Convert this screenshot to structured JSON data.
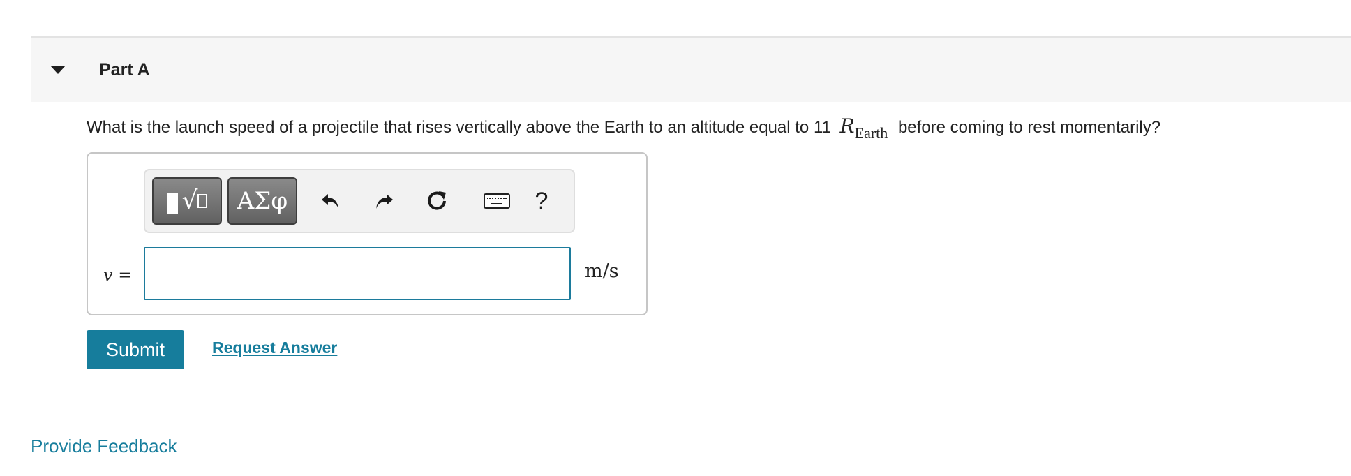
{
  "part": {
    "title": "Part A"
  },
  "question": {
    "text_before": "What is the launch speed of a projectile that rises vertically above the Earth to an altitude equal to 11",
    "math_symbol": "R",
    "math_subscript": "Earth",
    "text_after": "before coming to rest momentarily?"
  },
  "toolbar": {
    "templates_icon": "templates-sqrt-icon",
    "greek_label": "ΑΣφ",
    "undo_icon": "undo-icon",
    "redo_icon": "redo-icon",
    "reset_icon": "reset-icon",
    "keyboard_icon": "keyboard-icon",
    "help_label": "?"
  },
  "answer": {
    "variable": "v",
    "equals": "=",
    "value": "",
    "unit": "m/s"
  },
  "actions": {
    "submit_label": "Submit",
    "request_answer_label": "Request Answer"
  },
  "footer": {
    "feedback_label": "Provide Feedback"
  },
  "colors": {
    "accent": "#167d9c",
    "header_bg": "#f6f6f6",
    "input_border": "#1c7b9c"
  }
}
